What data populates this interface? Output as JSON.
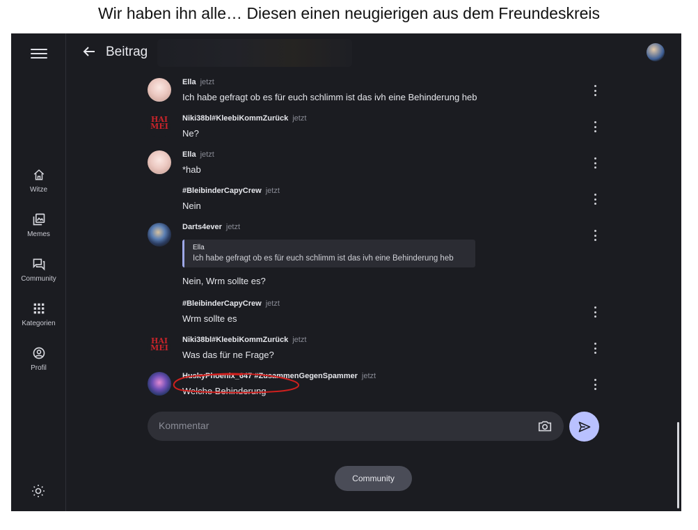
{
  "caption": "Wir haben ihn alle… Diesen einen neugierigen aus dem Freundeskreis",
  "header": {
    "title": "Beitrag",
    "back_icon": "arrow-left-icon"
  },
  "sidebar": {
    "items": [
      {
        "label": "Witze",
        "icon": "home-icon"
      },
      {
        "label": "Memes",
        "icon": "gallery-icon"
      },
      {
        "label": "Community",
        "icon": "forum-icon"
      },
      {
        "label": "Kategorien",
        "icon": "grid-icon"
      },
      {
        "label": "Profil",
        "icon": "account-icon"
      }
    ]
  },
  "comments": [
    {
      "author": "Ella",
      "time": "jetzt",
      "text": "Ich habe gefragt ob es für euch schlimm ist das ivh eine Behinderung heb"
    },
    {
      "author": "Niki38bl#KleebiKommZurück",
      "time": "jetzt",
      "text": "Ne?",
      "avatar_text": "HAI MEI"
    },
    {
      "author": "Ella",
      "time": "jetzt",
      "text": "*hab"
    },
    {
      "author": "#BleibinderCapyCrew",
      "time": "jetzt",
      "text": "Nein"
    },
    {
      "author": "Darts4ever",
      "time": "jetzt",
      "quote_author": "Ella",
      "quote_text": "Ich habe gefragt ob es für euch schlimm ist das ivh eine Behinderung heb",
      "text": "Nein, Wrm sollte es?"
    },
    {
      "author": "#BleibinderCapyCrew",
      "time": "jetzt",
      "text": "Wrm sollte es"
    },
    {
      "author": "Niki38bl#KleebiKommZurück",
      "time": "jetzt",
      "text": "Was das für ne Frage?",
      "avatar_text": "HAI MEI"
    },
    {
      "author": "HuskyPhoenix_647 #ZusammenGegenSpammer",
      "time": "jetzt",
      "text": "Welche Behinderung"
    }
  ],
  "composer": {
    "placeholder": "Kommentar"
  },
  "community_button": "Community",
  "colors": {
    "background": "#1b1c21",
    "accent": "#b9c1ff",
    "annotation": "#d0201e"
  }
}
